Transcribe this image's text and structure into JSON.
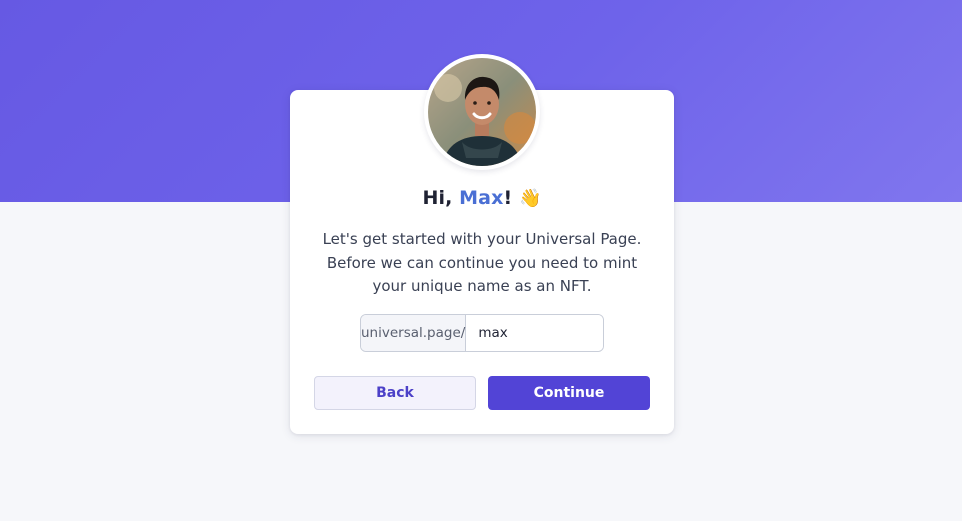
{
  "greeting": {
    "prefix": "Hi, ",
    "name": "Max",
    "suffix": "!",
    "emoji": "👋"
  },
  "message": {
    "line1": "Let's get started with your Universal Page.",
    "line2": "Before we can continue you need to mint",
    "line3": "your unique name as an NFT."
  },
  "url_field": {
    "prefix": "universal.page/",
    "value": "max"
  },
  "buttons": {
    "back_label": "Back",
    "continue_label": "Continue"
  },
  "colors": {
    "brand_gradient_start": "#6659e3",
    "brand_gradient_end": "#8076ee",
    "name_accent": "#4a6fd4",
    "primary_button": "#5244d6",
    "secondary_button_text": "#4c41c8"
  },
  "icons": {
    "avatar": "profile-photo",
    "wave": "waving-hand-emoji"
  }
}
